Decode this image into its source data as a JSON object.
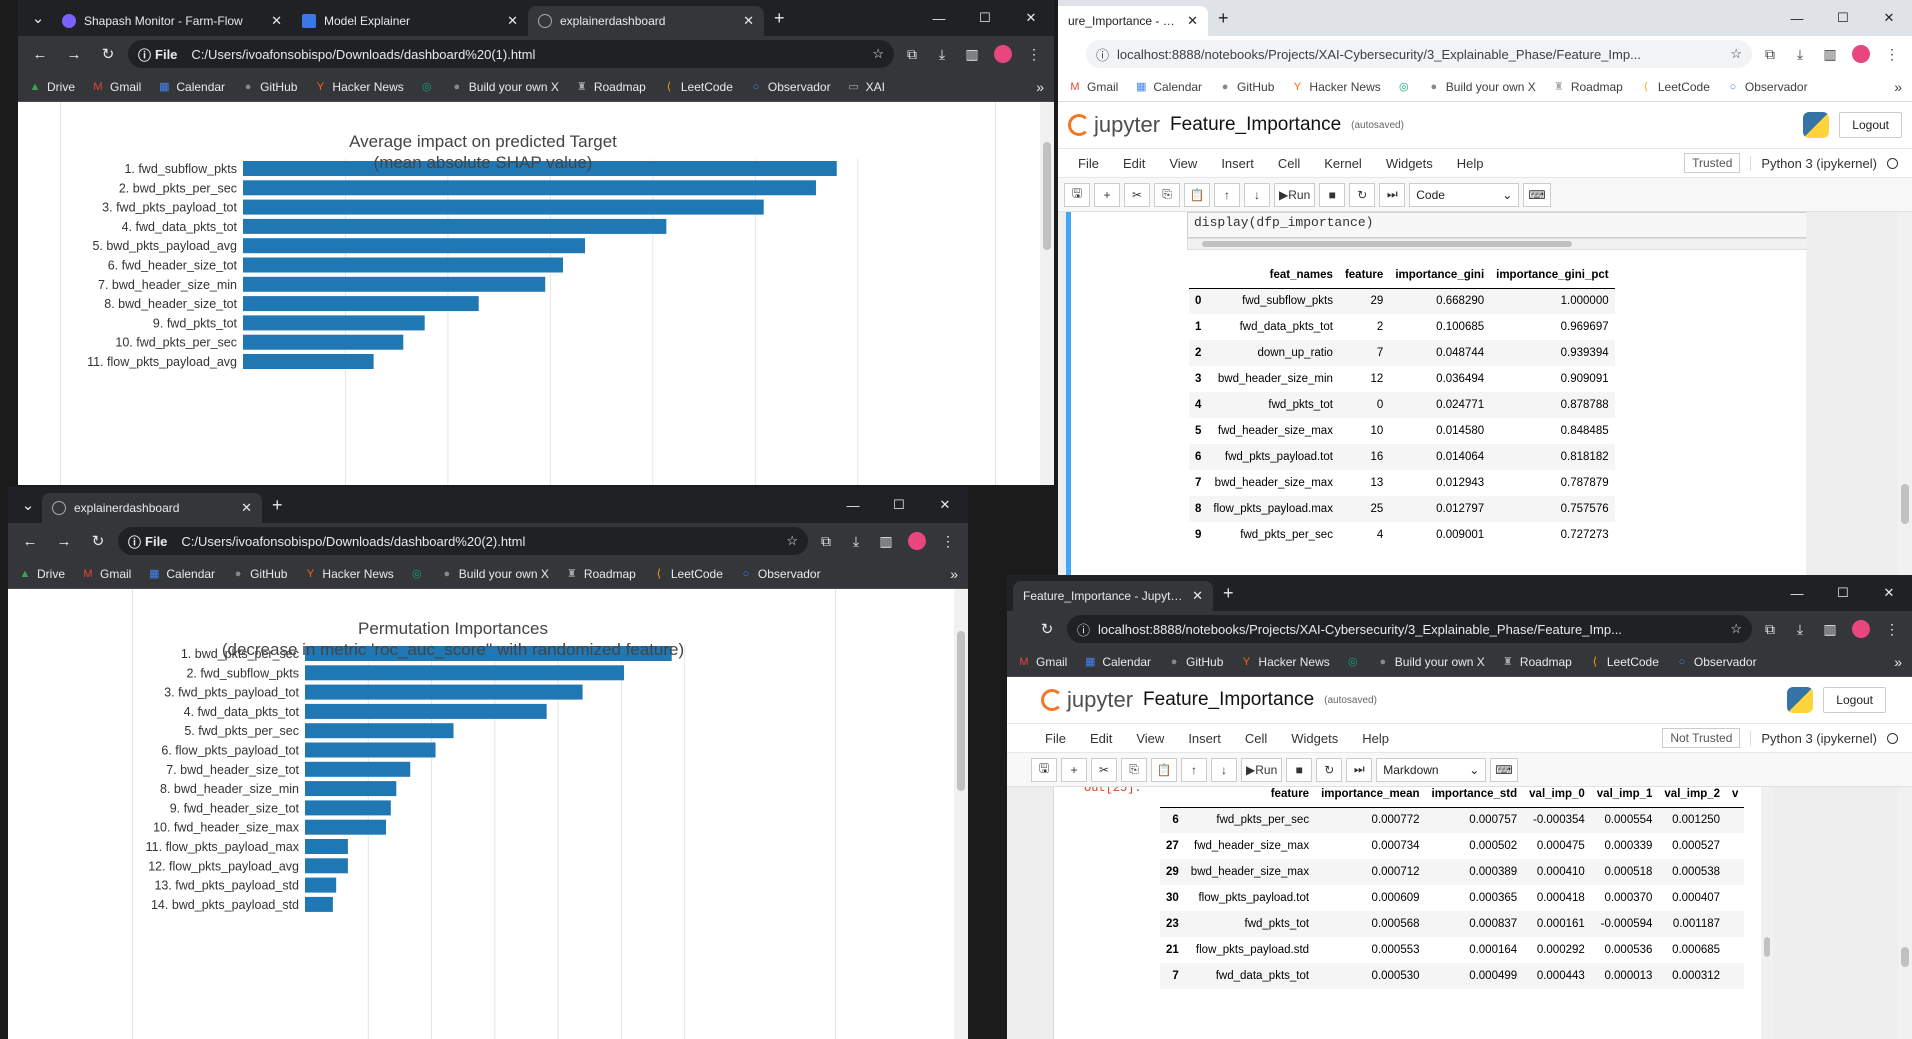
{
  "w1": {
    "tabs": [
      {
        "label": "Shapash Monitor - Farm-Flow"
      },
      {
        "label": "Model Explainer"
      },
      {
        "label": "explainerdashboard"
      }
    ],
    "url_chip": "File",
    "url": "C:/Users/ivoafonsobispo/Downloads/dashboard%20(1).html",
    "bookmarks": [
      "Drive",
      "Gmail",
      "Calendar",
      "GitHub",
      "Hacker News",
      "",
      "Build your own X",
      "Roadmap",
      "LeetCode",
      "Observador",
      "XAI"
    ]
  },
  "w2": {
    "tabs": [
      {
        "label": "explainerdashboard"
      }
    ],
    "url_chip": "File",
    "url": "C:/Users/ivoafonsobispo/Downloads/dashboard%20(2).html",
    "bookmarks": [
      "Drive",
      "Gmail",
      "Calendar",
      "GitHub",
      "Hacker News",
      "",
      "Build your own X",
      "Roadmap",
      "LeetCode",
      "Observador"
    ]
  },
  "w3": {
    "tab": "ure_Importance - Jupyter N",
    "url": "localhost:8888/notebooks/Projects/XAI-Cybersecurity/3_Explainable_Phase/Feature_Imp...",
    "bookmarks": [
      "Gmail",
      "Calendar",
      "GitHub",
      "Hacker News",
      "",
      "Build your own X",
      "Roadmap",
      "LeetCode",
      "Observador"
    ],
    "logo": "jupyter",
    "name": "Feature_Importance",
    "saved": "(autosaved)",
    "logout": "Logout",
    "menu": [
      "File",
      "Edit",
      "View",
      "Insert",
      "Cell",
      "Kernel",
      "Widgets",
      "Help"
    ],
    "trusted": "Trusted",
    "kernel": "Python 3 (ipykernel)",
    "run": "Run",
    "celltype": "Code",
    "code": "display(dfp_importance)",
    "table": {
      "columns": [
        "",
        "feat_names",
        "feature",
        "importance_gini",
        "importance_gini_pct"
      ],
      "rows": [
        [
          "0",
          "fwd_subflow_pkts",
          "29",
          "0.668290",
          "1.000000"
        ],
        [
          "1",
          "fwd_data_pkts_tot",
          "2",
          "0.100685",
          "0.969697"
        ],
        [
          "2",
          "down_up_ratio",
          "7",
          "0.048744",
          "0.939394"
        ],
        [
          "3",
          "bwd_header_size_min",
          "12",
          "0.036494",
          "0.909091"
        ],
        [
          "4",
          "fwd_pkts_tot",
          "0",
          "0.024771",
          "0.878788"
        ],
        [
          "5",
          "fwd_header_size_max",
          "10",
          "0.014580",
          "0.848485"
        ],
        [
          "6",
          "fwd_pkts_payload.tot",
          "16",
          "0.014064",
          "0.818182"
        ],
        [
          "7",
          "bwd_header_size_max",
          "13",
          "0.012943",
          "0.787879"
        ],
        [
          "8",
          "flow_pkts_payload.max",
          "25",
          "0.012797",
          "0.757576"
        ],
        [
          "9",
          "fwd_pkts_per_sec",
          "4",
          "0.009001",
          "0.727273"
        ]
      ]
    }
  },
  "w4": {
    "tab": "Feature_Importance - Jupyter N",
    "url": "localhost:8888/notebooks/Projects/XAI-Cybersecurity/3_Explainable_Phase/Feature_Imp...",
    "bookmarks": [
      "Gmail",
      "Calendar",
      "GitHub",
      "Hacker News",
      "",
      "Build your own X",
      "Roadmap",
      "LeetCode",
      "Observador"
    ],
    "logo": "jupyter",
    "name": "Feature_Importance",
    "saved": "(autosaved)",
    "logout": "Logout",
    "menu": [
      "File",
      "Edit",
      "View",
      "Insert",
      "Cell",
      "Widgets",
      "Help"
    ],
    "trusted": "Not Trusted",
    "kernel": "Python 3 (ipykernel)",
    "run": "Run",
    "celltype": "Markdown",
    "out_prompt": "Out[25]:",
    "table": {
      "columns": [
        "",
        "feature",
        "importance_mean",
        "importance_std",
        "val_imp_0",
        "val_imp_1",
        "val_imp_2",
        "v"
      ],
      "rows": [
        [
          "6",
          "fwd_pkts_per_sec",
          "0.000772",
          "0.000757",
          "-0.000354",
          "0.000554",
          "0.001250",
          ""
        ],
        [
          "27",
          "fwd_header_size_max",
          "0.000734",
          "0.000502",
          "0.000475",
          "0.000339",
          "0.000527",
          ""
        ],
        [
          "29",
          "bwd_header_size_max",
          "0.000712",
          "0.000389",
          "0.000410",
          "0.000518",
          "0.000538",
          ""
        ],
        [
          "30",
          "flow_pkts_payload.tot",
          "0.000609",
          "0.000365",
          "0.000418",
          "0.000370",
          "0.000407",
          ""
        ],
        [
          "23",
          "fwd_pkts_tot",
          "0.000568",
          "0.000837",
          "0.000161",
          "-0.000594",
          "0.001187",
          ""
        ],
        [
          "21",
          "flow_pkts_payload.std",
          "0.000553",
          "0.000164",
          "0.000292",
          "0.000536",
          "0.000685",
          ""
        ],
        [
          "7",
          "fwd_data_pkts_tot",
          "0.000530",
          "0.000499",
          "0.000443",
          "0.000013",
          "0.000312",
          ""
        ]
      ]
    }
  },
  "chart_data": [
    {
      "type": "bar",
      "orientation": "horizontal",
      "title": "Average impact on predicted Target",
      "subtitle": "(mean absolute SHAP value)",
      "categories": [
        "1. fwd_subflow_pkts",
        "2. bwd_pkts_per_sec",
        "3. fwd_pkts_payload_tot",
        "4. fwd_data_pkts_tot",
        "5. bwd_pkts_payload_avg",
        "6. fwd_header_size_tot",
        "7. bwd_header_size_min",
        "8. bwd_header_size_tot",
        "9. fwd_pkts_tot",
        "10. fwd_pkts_per_sec",
        "11. flow_pkts_payload_avg"
      ],
      "values": [
        1.0,
        0.965,
        0.877,
        0.713,
        0.576,
        0.539,
        0.509,
        0.397,
        0.306,
        0.27,
        0.22
      ],
      "color": "#1f77b4"
    },
    {
      "type": "bar",
      "orientation": "horizontal",
      "title": "Permutation Importances",
      "subtitle": "(decrease in metric 'roc_auc_score'' with randomized feature)",
      "categories": [
        "1. bwd_pkts_per_sec",
        "2. fwd_subflow_pkts",
        "3. fwd_pkts_payload_tot",
        "4. fwd_data_pkts_tot",
        "5. fwd_pkts_per_sec",
        "6. flow_pkts_payload_tot",
        "7. bwd_header_size_tot",
        "8. bwd_header_size_min",
        "9. fwd_header_size_tot",
        "10. fwd_header_size_max",
        "11. flow_pkts_payload_max",
        "12. flow_pkts_payload_avg",
        "13. fwd_pkts_payload_std",
        "14. bwd_pkts_payload_std"
      ],
      "values": [
        1.0,
        0.87,
        0.757,
        0.659,
        0.405,
        0.356,
        0.287,
        0.249,
        0.234,
        0.221,
        0.117,
        0.117,
        0.085,
        0.076
      ],
      "color": "#1f77b4"
    }
  ]
}
